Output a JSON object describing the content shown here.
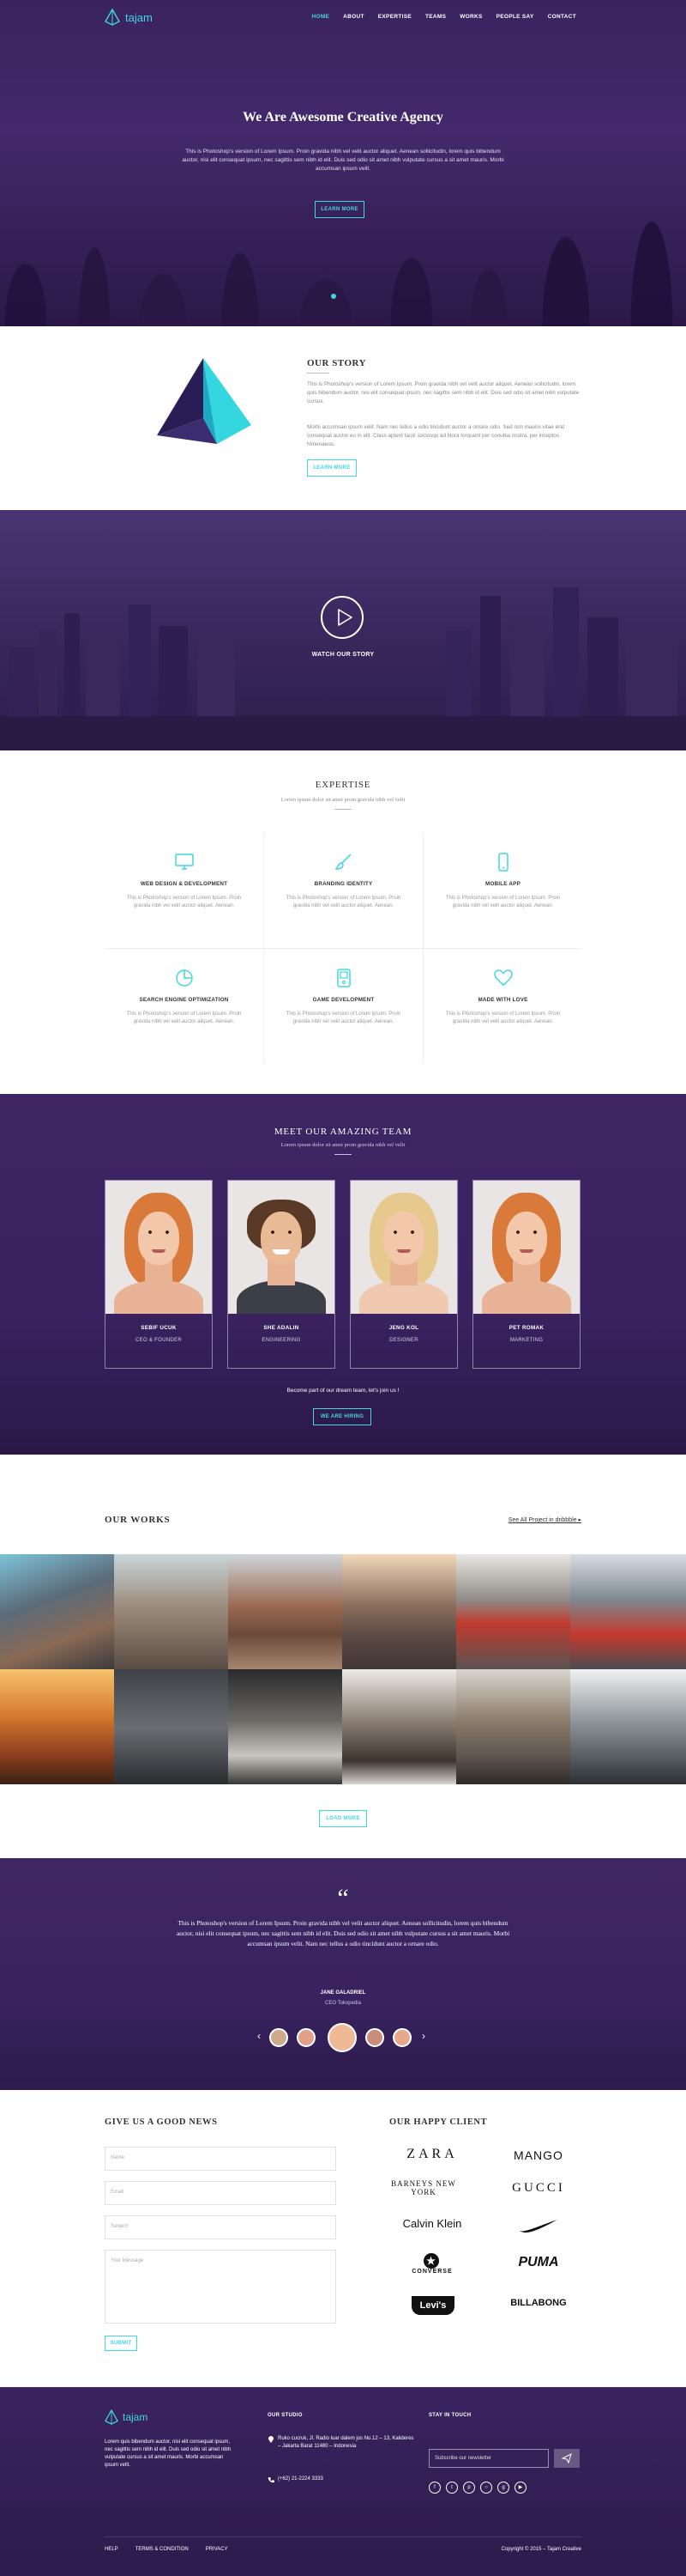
{
  "brand": {
    "name": "tajam"
  },
  "nav": {
    "items": [
      {
        "label": "HOME",
        "active": true
      },
      {
        "label": "ABOUT"
      },
      {
        "label": "EXPERTISE"
      },
      {
        "label": "TEAMS"
      },
      {
        "label": "WORKS"
      },
      {
        "label": "PEOPLE SAY"
      },
      {
        "label": "CONTACT"
      }
    ]
  },
  "hero": {
    "title": "We Are Awesome Creative Agency",
    "text": "This is Photoshop's version of Lorem Ipsum. Proin gravida nibh vel velit auctor aliquet. Aenean sollicitudin, lorem quis bibendum auctor, nisi elit consequat ipsum, nec sagittis sem nibh id elit. Duis sed odio sit amet nibh vulputate cursus a sit amet mauris. Morbi accumsan ipsum velit.",
    "button": "LEARN MORE"
  },
  "story": {
    "title": "OUR STORY",
    "p1": "This is Photoshop's version of Lorem Ipsum. Proin gravida nibh vel velit auctor aliquet. Aenean sollicitudin, lorem quis bibendum auctor, nisi elit consequat ipsum, nec sagittis sem nibh id elit. Duis sed odio sit amet nibh vulputate cursus.",
    "p2": "Morbi accumsan ipsum velit. Nam nec tellus a odio tincidunt auctor a ornare odio. Sed non mauris vitae erat consequat auctor eu in elit. Class aptent taciti sociosqu ad litora torquent per conubia nostra, per inceptos himenaeos.",
    "button": "LEARN MORE"
  },
  "video": {
    "label": "WATCH OUR STORY"
  },
  "expertise": {
    "title": "EXPERTISE",
    "subtitle": "Lorem ipsum dolor sit amet proin gravida nibh vel velit",
    "items": [
      {
        "icon": "monitor-icon",
        "title": "WEB DESIGN & DEVELOPMENT",
        "text": "This is Photoshop's version of Lorem Ipsum. Proin gravida nibh vel velit auctor aliquet. Aenean."
      },
      {
        "icon": "brush-icon",
        "title": "BRANDING IDENTITY",
        "text": "This is Photoshop's version of Lorem Ipsum. Proin gravida nibh vel velit auctor aliquet. Aenean."
      },
      {
        "icon": "mobile-icon",
        "title": "MOBILE APP",
        "text": "This is Photoshop's version of Lorem Ipsum. Proin gravida nibh vel velit auctor aliquet. Aenean."
      },
      {
        "icon": "pie-chart-icon",
        "title": "SEARCH ENGINE OPTIMIZATION",
        "text": "This is Photoshop's version of Lorem Ipsum. Proin gravida nibh vel velit auctor aliquet. Aenean."
      },
      {
        "icon": "gamepad-icon",
        "title": "GAME DEVELOPMENT",
        "text": "This is Photoshop's version of Lorem Ipsum. Proin gravida nibh vel velit auctor aliquet. Aenean."
      },
      {
        "icon": "heart-icon",
        "title": "MADE WITH LOVE",
        "text": "This is Photoshop's version of Lorem Ipsum. Proin gravida nibh vel velit auctor aliquet. Aenean."
      }
    ]
  },
  "team": {
    "title": "MEET OUR AMAZING TEAM",
    "subtitle": "Lorem ipsum dolor sit amet proin gravida nibh vel velit",
    "members": [
      {
        "name": "SEBIF UCUK",
        "role": "CEO & FOUNDER"
      },
      {
        "name": "SHE ADALIN",
        "role": "ENGINEERING"
      },
      {
        "name": "JENG KOL",
        "role": "DESIGNER"
      },
      {
        "name": "PET ROMAK",
        "role": "MARKETING"
      }
    ],
    "note": "Become part of our dream team, let's join us !",
    "button": "WE ARE HIRING"
  },
  "works": {
    "title": "OUR WORKS",
    "link": "See All Project in dribbble",
    "button": "LOAD MORE"
  },
  "testimonial": {
    "quote": "This is Photoshop's version of Lorem Ipsum. Proin gravida nibh vel velit auctor aliquet. Aenean sollicitudin, lorem quis bibendum auctor, nisi elit consequat ipsum, nec sagittis sem nibh id elit. Duis sed odio sit amet nibh vulputate cursus a sit amet mauris. Morbi accumsan ipsum velit. Nam nec tellus a odio tincidunt auctor a ornare odio.",
    "name": "JANE GALADRIEL",
    "role": "CEO Tokopedia"
  },
  "contact": {
    "title": "GIVE US A GOOD NEWS",
    "name_placeholder": "Name",
    "email_placeholder": "Email",
    "subject_placeholder": "Subject",
    "message_placeholder": "Your Message",
    "button": "SUBMIT"
  },
  "clients": {
    "title": "OUR HAPPY CLIENT",
    "brands": [
      "ZARA",
      "MANGO",
      "BARNEYS NEW YORK",
      "GUCCI",
      "Calvin Klein",
      "Nike",
      "CONVERSE",
      "PUMA",
      "Levi's",
      "BILLABONG"
    ]
  },
  "footer": {
    "about": "Lorem quis bibendum auctor, nisi elit consequat ipsum, nec sagittis sem nibh id elit. Duis sed odio sit amet nibh vulputate cursus a sit amet mauris. Morbi accumsan ipsum velit.",
    "studio_title": "OUR STUDIO",
    "address": "Ruko cucruk, Jl. Radio luar dalem jos No.12 – 13, Kalideres – Jakarta Barat 11480 – Indonesia",
    "phone": "(+62) 21-2224 3333",
    "touch_title": "STAY IN TOUCH",
    "subscribe_placeholder": "Subscribe our newsletter",
    "links": [
      "HELP",
      "TERMS & CONDITION",
      "PRIVACY"
    ],
    "copyright": "Copyright © 2015 – Tajam Creative"
  },
  "colors": {
    "accent": "#3fd8e0",
    "purple": "#3e2563"
  }
}
